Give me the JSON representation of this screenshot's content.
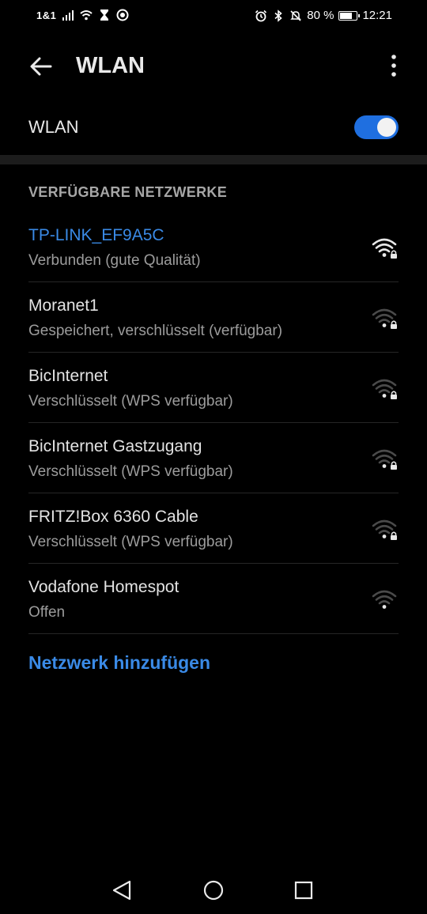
{
  "status_bar": {
    "carrier": "1&1",
    "battery_percent": "80 %",
    "battery_level": 0.8,
    "time": "12:21"
  },
  "app_bar": {
    "title": "WLAN",
    "back_icon": "arrow-left-icon",
    "menu_icon": "more-vert-icon"
  },
  "wlan_toggle": {
    "label": "WLAN",
    "enabled": true,
    "accent": "#1f6fe0"
  },
  "networks_section": {
    "header": "VERFÜGBARE NETZWERKE",
    "items": [
      {
        "name": "TP-LINK_EF9A5C",
        "status": "Verbunden (gute Qualität)",
        "connected": true,
        "secured": true,
        "signal": 4
      },
      {
        "name": "Moranet1",
        "status": "Gespeichert, verschlüsselt (verfügbar)",
        "connected": false,
        "secured": true,
        "signal": 1
      },
      {
        "name": "BicInternet",
        "status": "Verschlüsselt (WPS verfügbar)",
        "connected": false,
        "secured": true,
        "signal": 1
      },
      {
        "name": "BicInternet Gastzugang",
        "status": "Verschlüsselt (WPS verfügbar)",
        "connected": false,
        "secured": true,
        "signal": 1
      },
      {
        "name": "FRITZ!Box 6360 Cable",
        "status": "Verschlüsselt (WPS verfügbar)",
        "connected": false,
        "secured": true,
        "signal": 1
      },
      {
        "name": "Vodafone Homespot",
        "status": "Offen",
        "connected": false,
        "secured": false,
        "signal": 1
      }
    ]
  },
  "add_network": {
    "label": "Netzwerk hinzufügen"
  },
  "colors": {
    "accent": "#3a8ae6",
    "background": "#000000"
  }
}
